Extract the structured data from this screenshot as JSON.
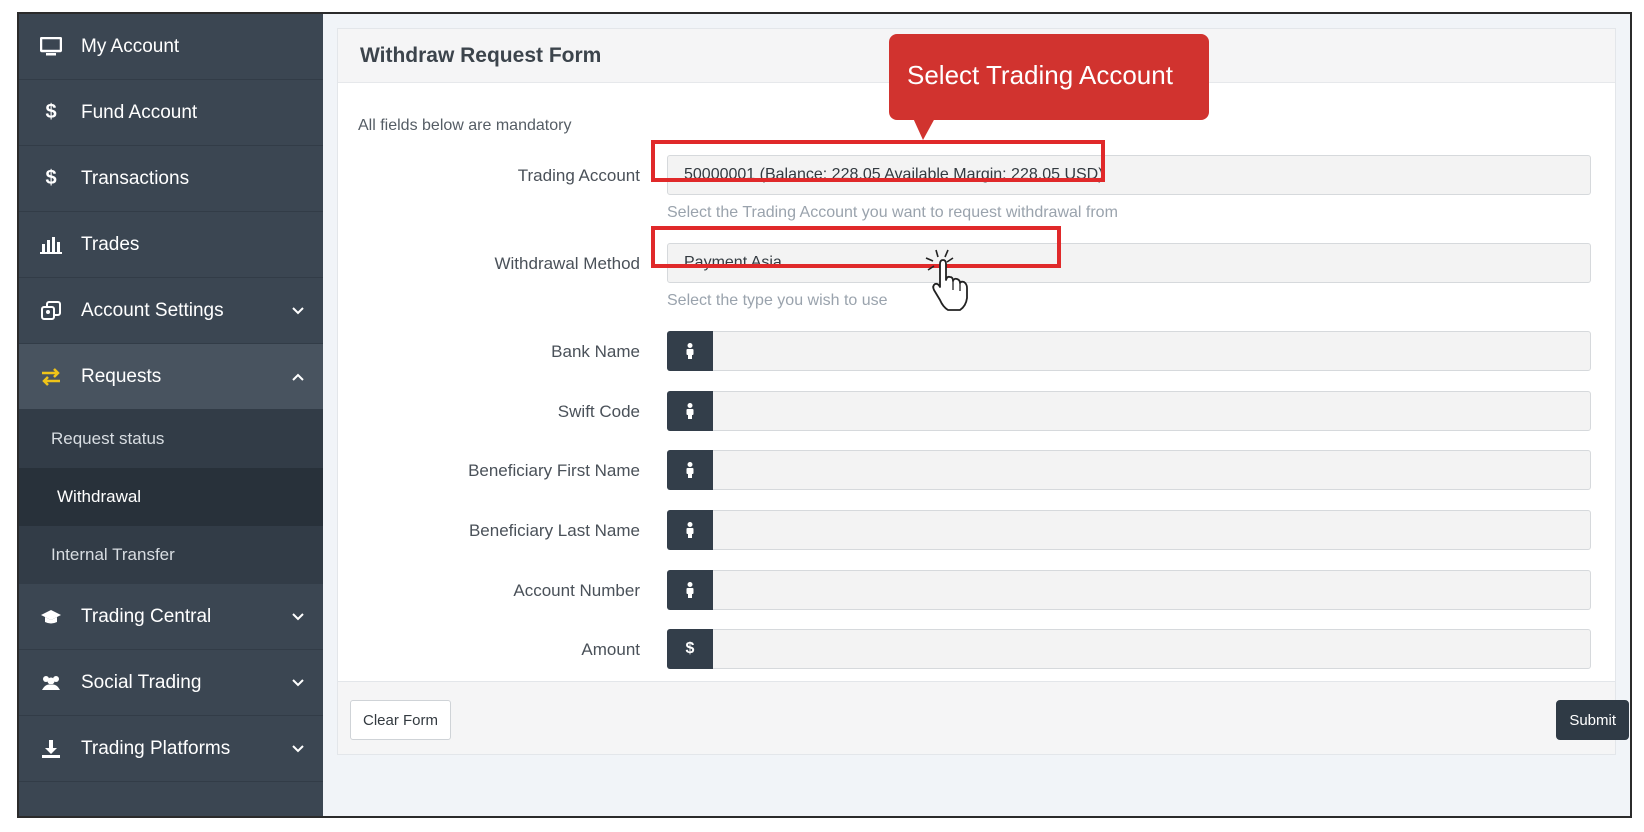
{
  "sidebar": {
    "items": [
      {
        "label": "My Account",
        "icon": "monitor-icon"
      },
      {
        "label": "Fund Account",
        "icon": "dollar-icon"
      },
      {
        "label": "Transactions",
        "icon": "dollar-icon"
      },
      {
        "label": "Trades",
        "icon": "bar-chart-icon"
      },
      {
        "label": "Account Settings",
        "icon": "settings-copy-icon"
      },
      {
        "label": "Requests",
        "icon": "exchange-icon"
      },
      {
        "label": "Trading Central",
        "icon": "graduation-cap-icon"
      },
      {
        "label": "Social Trading",
        "icon": "users-icon"
      },
      {
        "label": "Trading Platforms",
        "icon": "download-icon"
      }
    ],
    "sub_items": [
      {
        "label": "Request status"
      },
      {
        "label": "Withdrawal"
      },
      {
        "label": "Internal Transfer"
      }
    ],
    "colors": {
      "background": "#3b4652",
      "active": "#48535f",
      "submenu": "#323c47",
      "current_sub": "#28313a",
      "requests_icon": "#f0c419"
    }
  },
  "form": {
    "title": "Withdraw Request Form",
    "note": "All fields below are mandatory",
    "trading_account": {
      "label": "Trading Account",
      "value": "50000001 (Balance: 228.05 Available Margin: 228.05 USD)",
      "help": "Select the Trading Account you want to request withdrawal from"
    },
    "withdrawal_method": {
      "label": "Withdrawal Method",
      "value": "Payment Asia",
      "help": "Select the type you wish to use"
    },
    "fields": [
      {
        "label": "Bank Name",
        "addon": "person-icon",
        "value": ""
      },
      {
        "label": "Swift Code",
        "addon": "person-icon",
        "value": ""
      },
      {
        "label": "Beneficiary First Name",
        "addon": "person-icon",
        "value": ""
      },
      {
        "label": "Beneficiary Last Name",
        "addon": "person-icon",
        "value": ""
      },
      {
        "label": "Account Number",
        "addon": "person-icon",
        "value": ""
      },
      {
        "label": "Amount",
        "addon": "dollar-icon",
        "addon_text": "$",
        "value": ""
      }
    ],
    "buttons": {
      "clear": "Clear Form",
      "submit": "Submit"
    }
  },
  "annotation": {
    "callout_text": "Select Trading Account",
    "callout_color": "#d1332f",
    "highlight_color": "#e0292a",
    "cursor_icon": "hand-pointer-icon"
  }
}
